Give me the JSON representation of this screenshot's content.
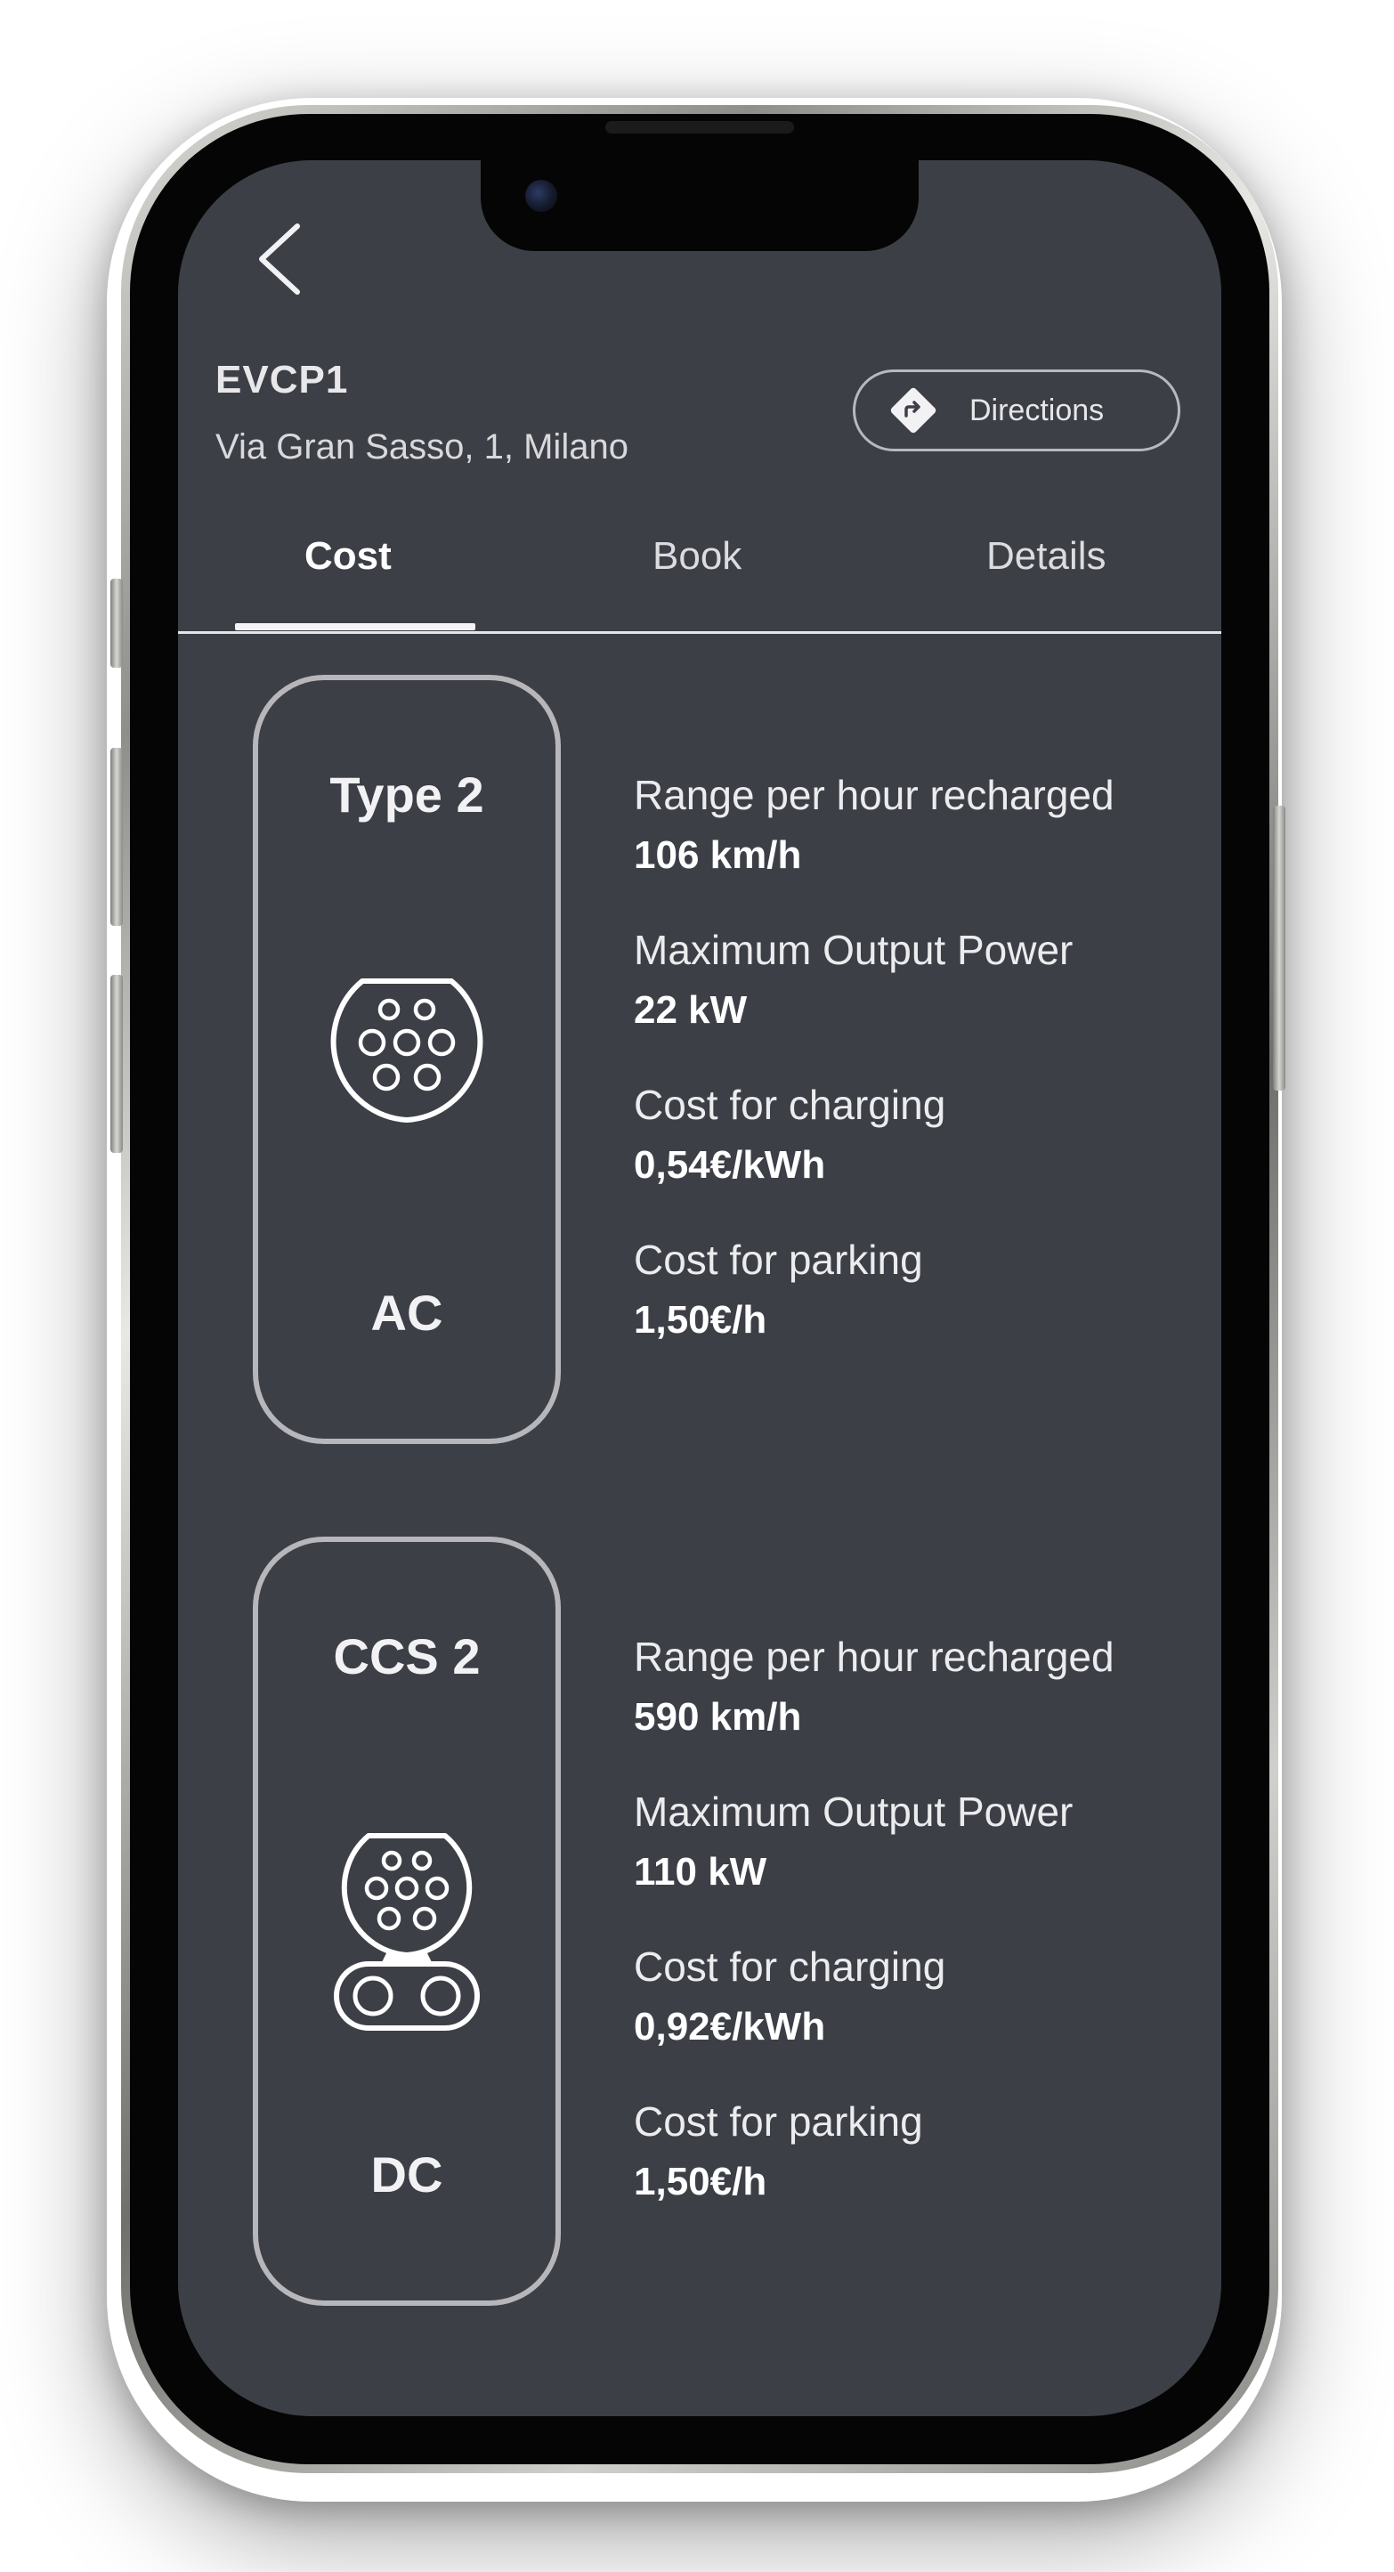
{
  "header": {
    "station_name": "EVCP1",
    "address": "Via Gran Sasso, 1, Milano",
    "directions_label": "Directions"
  },
  "tabs": [
    {
      "label": "Cost",
      "active": true
    },
    {
      "label": "Book",
      "active": false
    },
    {
      "label": "Details",
      "active": false
    }
  ],
  "connectors": [
    {
      "type": "Type 2",
      "current": "AC",
      "icon": "type2-plug-icon",
      "specs": [
        {
          "label": "Range per hour recharged",
          "value": "106 km/h"
        },
        {
          "label": "Maximum Output Power",
          "value": "22 kW"
        },
        {
          "label": "Cost for charging",
          "value": "0,54€/kWh"
        },
        {
          "label": "Cost for parking",
          "value": "1,50€/h"
        }
      ]
    },
    {
      "type": "CCS 2",
      "current": "DC",
      "icon": "ccs2-plug-icon",
      "specs": [
        {
          "label": "Range per hour recharged",
          "value": "590 km/h"
        },
        {
          "label": "Maximum Output Power",
          "value": "110 kW"
        },
        {
          "label": "Cost for charging",
          "value": "0,92€/kWh"
        },
        {
          "label": "Cost for parking",
          "value": "1,50€/h"
        }
      ]
    }
  ],
  "colors": {
    "screen_background": "#3d3f47",
    "text_primary": "#ffffff",
    "card_border": "#b7b7bb"
  }
}
